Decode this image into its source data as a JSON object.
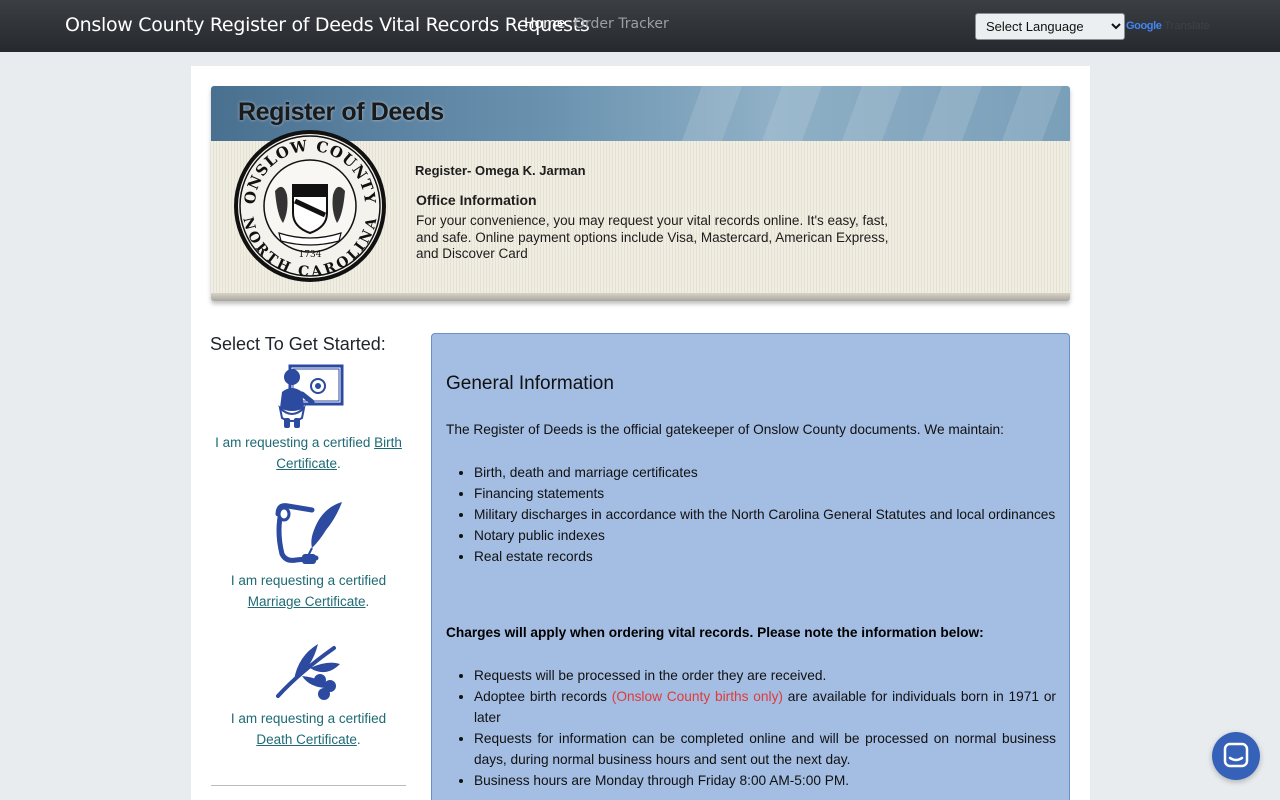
{
  "navbar": {
    "brand": "Onslow County Register of Deeds Vital Records Requests",
    "links": [
      {
        "label": "Home"
      },
      {
        "label": "Order Tracker"
      }
    ],
    "language_select": "Select Language",
    "google_label": "Google",
    "translate_label": "Translate"
  },
  "banner": {
    "title": "Register of Deeds",
    "seal_top": "ONSLOW COUNTY",
    "seal_bottom": "NORTH CAROLINA",
    "seal_year": "1734",
    "register": "Register- Omega K. Jarman",
    "office_title": "Office Information",
    "office_text": "For your convenience, you may request your vital records online.  It's easy, fast, and safe.  Online payment options include Visa, Mastercard, American Express, and Discover Card"
  },
  "sidebar": {
    "heading": "Select To Get Started:",
    "options": [
      {
        "prefix": "I am requesting a certified ",
        "link": "Birth Certificate",
        "suffix": "."
      },
      {
        "prefix": "I am requesting a certified ",
        "link": "Marriage Certificate",
        "suffix": "."
      },
      {
        "prefix": "I am requesting a certified ",
        "link": "Death Certificate",
        "suffix": "."
      }
    ]
  },
  "info": {
    "title": "General Information",
    "intro": "The Register of Deeds is the official gatekeeper of Onslow County documents. We maintain:",
    "maintain_items": [
      "Birth, death and marriage certificates",
      "Financing statements",
      "Military discharges in accordance with the North Carolina General Statutes and local ordinances",
      "Notary public indexes",
      "Real estate records"
    ],
    "charges": "Charges will apply when ordering vital records.  Please note the information below:",
    "notes": [
      "Requests will be processed in the order they are received.",
      "Adoptee birth records ",
      "(Onslow County births only)",
      " are available for individuals born in 1971 or later",
      "Requests for information can be completed online and will be processed on normal business days, during normal business hours and sent out the next day.",
      "Business hours are Monday through Friday 8:00 AM-5:00 PM."
    ]
  },
  "colors": {
    "navbar": "#2c3035",
    "link": "#1e6a75",
    "panel": "#a3bde3",
    "icon": "#2b4aa0",
    "highlight": "#e03a3a"
  },
  "icons": [
    "baby-certificate-icon",
    "quill-scroll-icon",
    "olive-branch-icon",
    "chat-icon"
  ]
}
